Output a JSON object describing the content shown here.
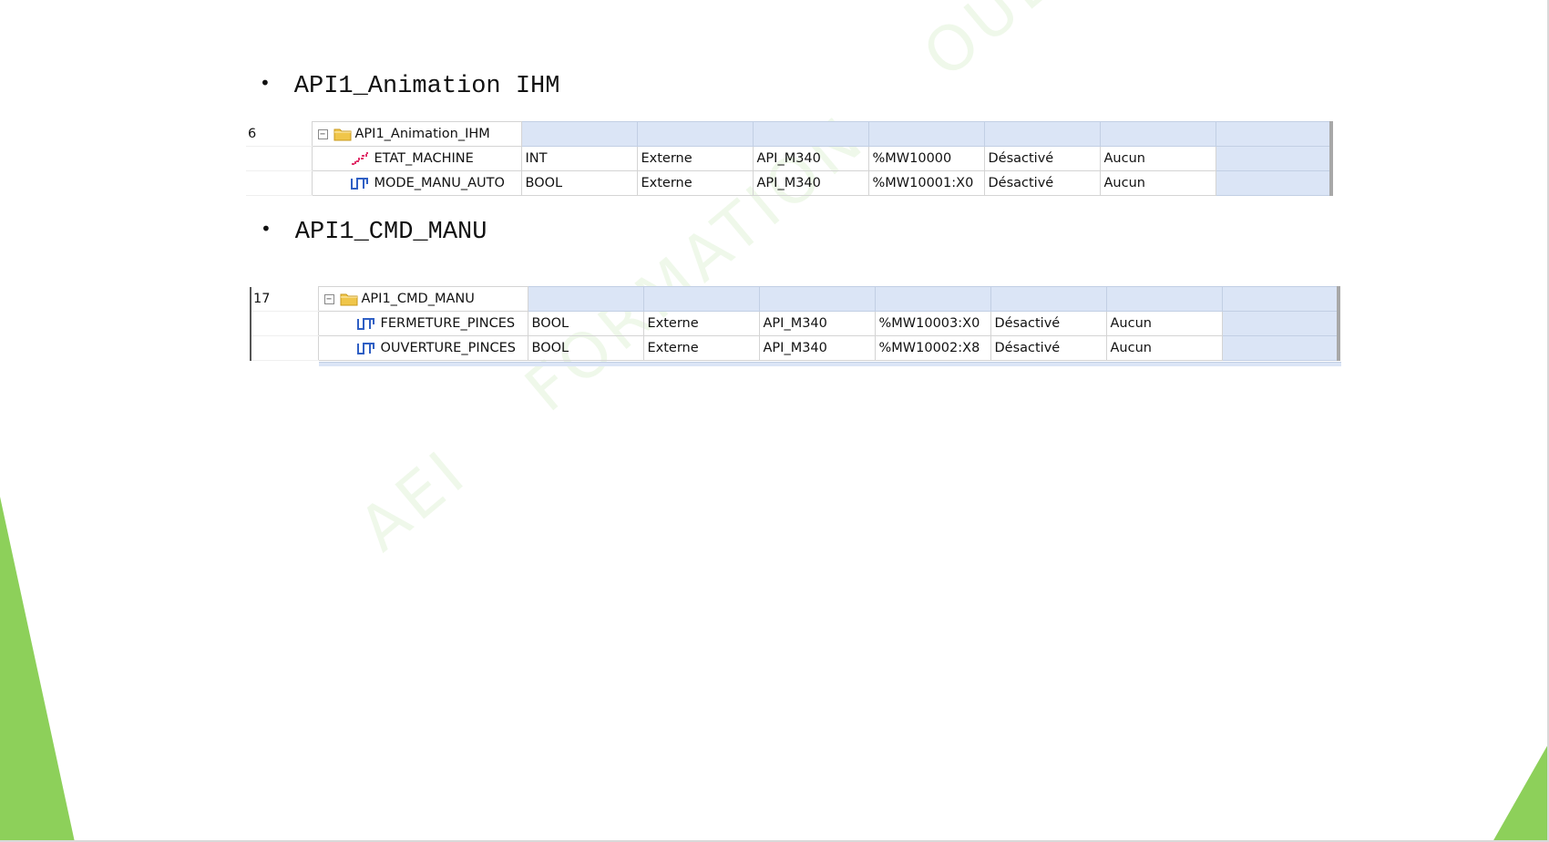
{
  "watermark": "AEI    FORMATION    OUEST",
  "sections": [
    {
      "bullet": "•",
      "heading": "API1_Animation IHM",
      "group_index": "6",
      "group_name": "API1_Animation_IHM",
      "variables": [
        {
          "icon": "int-stairs-icon",
          "name": "ETAT_MACHINE",
          "type": "INT",
          "scope": "Externe",
          "device": "API_M340",
          "address": "%MW10000",
          "state": "Désactivé",
          "option": "Aucun"
        },
        {
          "icon": "bool-pulse-icon",
          "name": "MODE_MANU_AUTO",
          "type": "BOOL",
          "scope": "Externe",
          "device": "API_M340",
          "address": "%MW10001:X0",
          "state": "Désactivé",
          "option": "Aucun"
        }
      ]
    },
    {
      "bullet": "•",
      "heading": "API1_CMD_MANU",
      "group_index": "17",
      "group_name": "API1_CMD_MANU",
      "variables": [
        {
          "icon": "bool-pulse-icon",
          "name": "FERMETURE_PINCES",
          "type": "BOOL",
          "scope": "Externe",
          "device": "API_M340",
          "address": "%MW10003:X0",
          "state": "Désactivé",
          "option": "Aucun"
        },
        {
          "icon": "bool-pulse-icon",
          "name": "OUVERTURE_PINCES",
          "type": "BOOL",
          "scope": "Externe",
          "device": "API_M340",
          "address": "%MW10002:X8",
          "state": "Désactivé",
          "option": "Aucun"
        }
      ]
    }
  ],
  "colors": {
    "accent_green": "#8dd05a",
    "row_blue": "#dbe5f6",
    "int_icon": "#e0306a",
    "bool_icon": "#2f5fc4",
    "folder": "#f0c64a"
  }
}
